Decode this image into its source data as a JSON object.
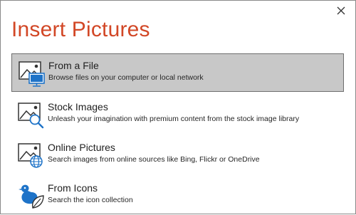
{
  "dialog": {
    "title": "Insert Pictures",
    "close_icon": "close-icon",
    "options": [
      {
        "title": "From a File",
        "description": "Browse files on your computer or local network",
        "icon": "picture-monitor-icon",
        "selected": true
      },
      {
        "title": "Stock Images",
        "description": "Unleash your imagination with premium content from the stock image library",
        "icon": "picture-search-icon",
        "selected": false
      },
      {
        "title": "Online Pictures",
        "description": "Search images from online sources like Bing, Flickr or OneDrive",
        "icon": "picture-globe-icon",
        "selected": false
      },
      {
        "title": "From Icons",
        "description": "Search the icon collection",
        "icon": "bird-leaf-icon",
        "selected": false
      }
    ]
  },
  "colors": {
    "title": "#d24726",
    "accent_blue": "#1e73c8",
    "selected_bg": "#c8c8c8"
  }
}
